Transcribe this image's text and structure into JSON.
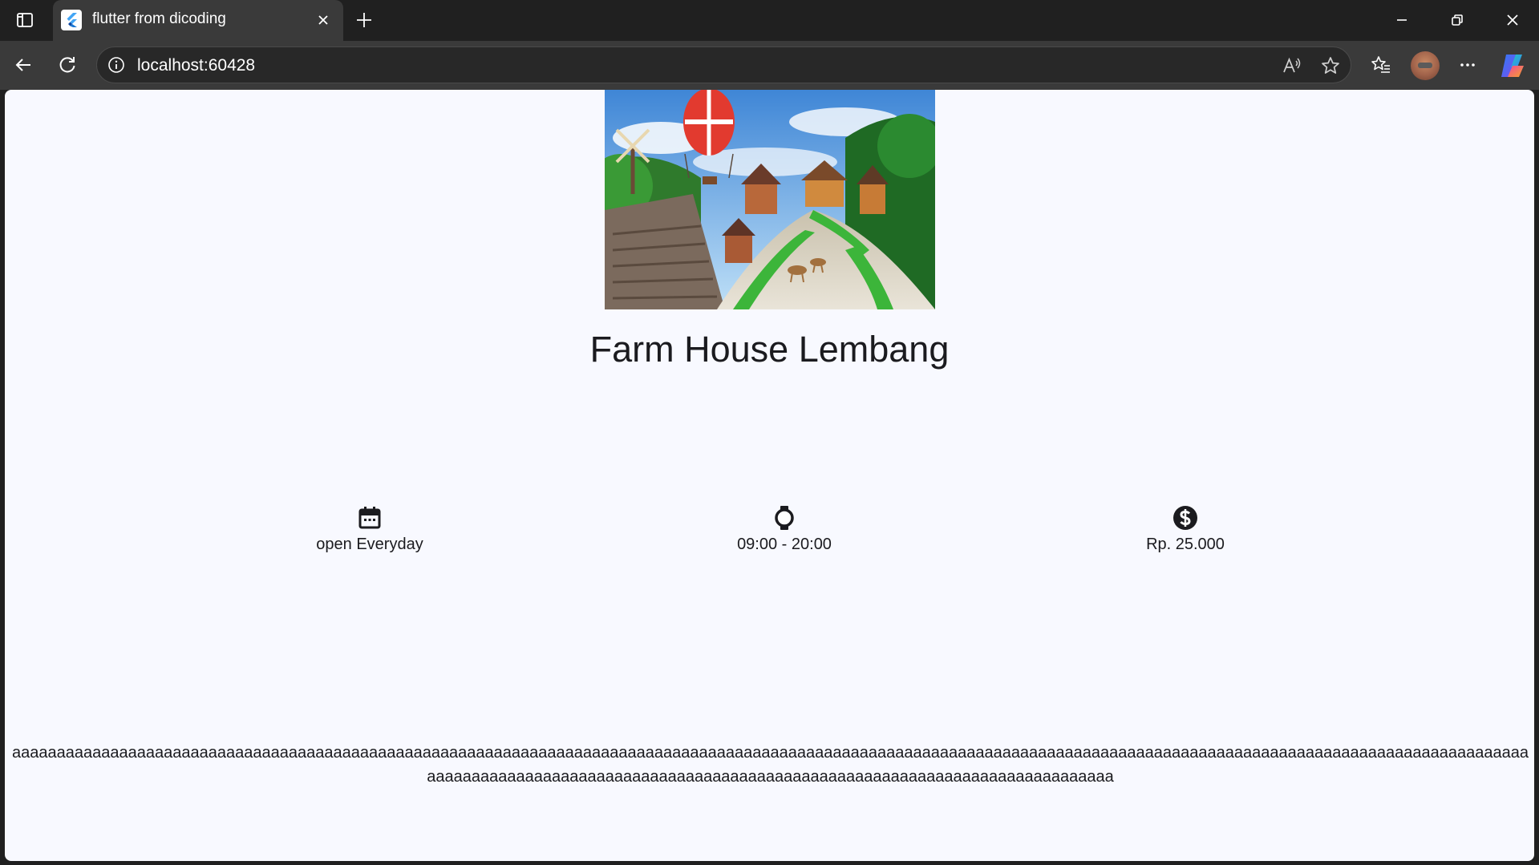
{
  "browser": {
    "tab_title": "flutter from dicoding",
    "url": "localhost:60428"
  },
  "colors": {
    "frame": "#202020",
    "toolbar": "#3a3a3a",
    "page_background": "#f8f9ff",
    "text": "#1b1b1f"
  },
  "page": {
    "hero_image": "hero-image-farm-house",
    "title": "Farm House Lembang",
    "info": [
      {
        "icon": "calendar-icon",
        "label": "open Everyday"
      },
      {
        "icon": "watch-icon",
        "label": "09:00 - 20:00"
      },
      {
        "icon": "dollar-icon",
        "label": "Rp. 25.000"
      }
    ],
    "description": "aaaaaaaaaaaaaaaaaaaaaaaaaaaaaaaaaaaaaaaaaaaaaaaaaaaaaaaaaaaaaaaaaaaaaaaaaaaaaaaaaaaaaaaaaaaaaaaaaaaaaaaaaaaaaaaaaaaaaaaaaaaaaaaaaaaaaaaaaaaaaaaaaaaaaaaaaaaaaaaaaaaaaaaaaaaaaaaaaaaaaaaaaaaaaaaaaaaaaaaaaaaaaaaaaaaaaaaaaaaaaaaaaaaaaaaaaaaaaaaaaaaaaaa"
  }
}
